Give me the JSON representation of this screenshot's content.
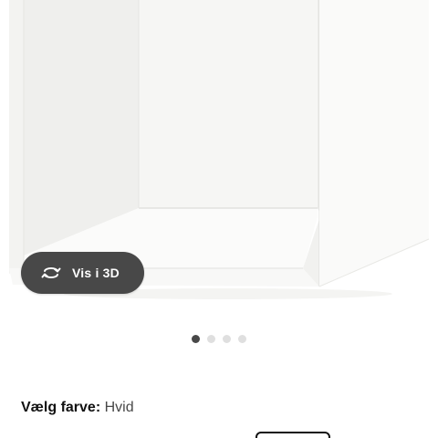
{
  "product": {
    "image_alt": "White open wall cabinet",
    "view_3d_label": "Vis i 3D",
    "icon": "rotate-3d-icon"
  },
  "carousel": {
    "total": 4,
    "active_index": 0
  },
  "color_picker": {
    "label": "Vælg farve:",
    "selected": "Hvid"
  },
  "colors": {
    "button_bg": "#484848",
    "dot_active": "#484848",
    "dot_inactive": "#dfdfdf",
    "text": "#111111"
  }
}
